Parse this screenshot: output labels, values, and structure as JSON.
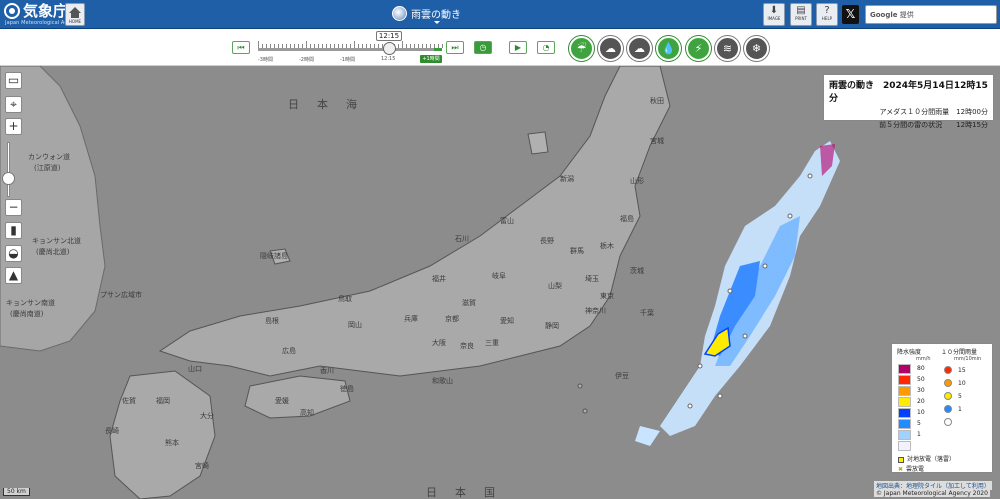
{
  "header": {
    "logo_text": "気象庁",
    "logo_sub": "Japan Meteorological Agency",
    "home_label": "HOME",
    "page_title": "雨雲の動き",
    "image_label": "IMAGE",
    "print_label": "PRINT",
    "help_label": "HELP",
    "x_label": "𝕏",
    "search_brand": "Google",
    "search_placeholder": "提供"
  },
  "timeline": {
    "current_time": "12:15",
    "labels": [
      "-3時間",
      "-2時間",
      "-1時間",
      "12:15",
      "+1時間"
    ],
    "position_fraction": 0.82
  },
  "layer_buttons": [
    "rain-radar",
    "cloud",
    "cloud-forecast",
    "rain-amount",
    "thunder",
    "wind",
    "snow"
  ],
  "info": {
    "title": "雨雲の動き　2024年5月14日12時15分",
    "line1": "アメダス１０分間雨量　12時00分",
    "line2": "前５分間の雷の状況　　12時15分"
  },
  "legend": {
    "rain_head": "降水強度",
    "rain_unit": "mm/h",
    "amedas_head": "１０分間雨量",
    "amedas_unit": "mm/10min",
    "rain_levels": [
      {
        "label": "80",
        "color": "#b4006a"
      },
      {
        "label": "50",
        "color": "#ff2800"
      },
      {
        "label": "30",
        "color": "#ff9900"
      },
      {
        "label": "20",
        "color": "#ffeb00"
      },
      {
        "label": "10",
        "color": "#0041ff"
      },
      {
        "label": "5",
        "color": "#218cff"
      },
      {
        "label": "1",
        "color": "#a0d2ff"
      },
      {
        "label": "",
        "color": "#f2f2ff"
      }
    ],
    "amedas_levels": [
      {
        "label": "15",
        "color": "#ff2800"
      },
      {
        "label": "10",
        "color": "#ff9900"
      },
      {
        "label": "5",
        "color": "#ffeb00"
      },
      {
        "label": "1",
        "color": "#218cff"
      },
      {
        "label": "",
        "color": "#ffffff"
      }
    ],
    "lightning1": "対地放電（落雷）",
    "lightning2": "雲放電"
  },
  "map_labels": {
    "sea_north": "日本海",
    "sea_south": "日本国",
    "kangwon": "カンウォン道",
    "kangwon2": "(江原道)",
    "gyeongsang_n": "キョンサン北道",
    "gyeongsang_n2": "(慶尚北道)",
    "gyeongsang_s": "キョンサン南道",
    "gyeongsang_s2": "(慶尚南道)",
    "busan": "プサン広域市",
    "oki": "隠岐諸島",
    "prefectures": [
      "新潟",
      "山形",
      "福島",
      "石川",
      "富山",
      "長野",
      "群馬",
      "栃木",
      "茨城",
      "福井",
      "岐阜",
      "山梨",
      "埼玉",
      "東京",
      "千葉",
      "神奈川",
      "静岡",
      "愛知",
      "滋賀",
      "京都",
      "兵庫",
      "大阪",
      "奈良",
      "三重",
      "和歌山",
      "鳥取",
      "岡山",
      "島根",
      "広島",
      "山口",
      "香川",
      "徳島",
      "愛媛",
      "高知",
      "福岡",
      "大分",
      "佐賀",
      "熊本",
      "宮崎",
      "長崎",
      "秋田",
      "宮城",
      "伊豆"
    ],
    "scale": "50 km"
  },
  "credits": {
    "source": "地図出典：地理院タイル（加工して利用）",
    "copyright": "© Japan Meteorological Agency 2020"
  },
  "colors": {
    "header_bg": "#1f5fa8",
    "active_green": "#3fa33f",
    "map_bg": "#8c8c8c"
  }
}
